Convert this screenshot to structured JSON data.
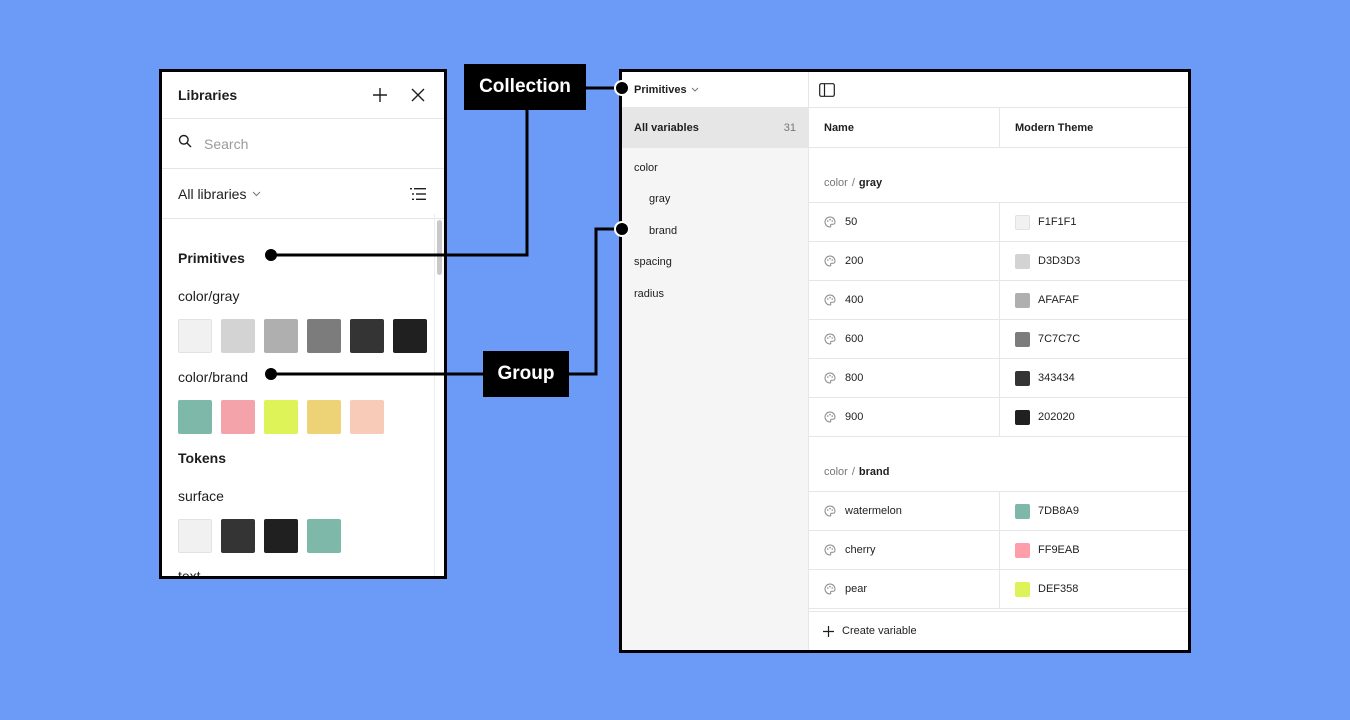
{
  "libraries": {
    "title": "Libraries",
    "search_placeholder": "Search",
    "filter_label": "All libraries",
    "sections": {
      "primitives": {
        "title": "Primitives",
        "groups": {
          "gray": {
            "title": "color/gray",
            "swatches": [
              "#F1F1F1",
              "#D3D3D3",
              "#AFAFAF",
              "#7C7C7C",
              "#343434",
              "#202020"
            ]
          },
          "brand": {
            "title": "color/brand",
            "swatches": [
              "#7DB8A9",
              "#F4A3AB",
              "#DEF358",
              "#EDD276",
              "#F7CBB8"
            ]
          }
        }
      },
      "tokens": {
        "title": "Tokens",
        "groups": {
          "surface": {
            "title": "surface",
            "swatches": [
              "#F1F1F1",
              "#343434",
              "#202020",
              "#7DB8A9"
            ]
          },
          "text": {
            "title": "text"
          }
        }
      }
    }
  },
  "variables": {
    "collection_name": "Primitives",
    "sidebar": {
      "all_label": "All variables",
      "all_count": "31",
      "items": [
        "color",
        "gray",
        "brand",
        "spacing",
        "radius"
      ]
    },
    "columns": {
      "name": "Name",
      "mode": "Modern Theme"
    },
    "groups": [
      {
        "prefix": "color",
        "name": "gray",
        "rows": [
          {
            "name": "50",
            "value": "F1F1F1",
            "color": "#F1F1F1"
          },
          {
            "name": "200",
            "value": "D3D3D3",
            "color": "#D3D3D3"
          },
          {
            "name": "400",
            "value": "AFAFAF",
            "color": "#AFAFAF"
          },
          {
            "name": "600",
            "value": "7C7C7C",
            "color": "#7C7C7C"
          },
          {
            "name": "800",
            "value": "343434",
            "color": "#343434"
          },
          {
            "name": "900",
            "value": "202020",
            "color": "#202020"
          }
        ]
      },
      {
        "prefix": "color",
        "name": "brand",
        "rows": [
          {
            "name": "watermelon",
            "value": "7DB8A9",
            "color": "#7DB8A9"
          },
          {
            "name": "cherry",
            "value": "FF9EAB",
            "color": "#FF9EAB"
          },
          {
            "name": "pear",
            "value": "DEF358",
            "color": "#DEF358"
          }
        ]
      }
    ],
    "create_label": "Create variable"
  },
  "callouts": {
    "collection": "Collection",
    "group": "Group"
  },
  "colors": {
    "background": "#6B9BF7",
    "panel_border": "#000000",
    "sidebar_bg": "#F5F5F5",
    "selected_bg": "#E6E6E6"
  }
}
